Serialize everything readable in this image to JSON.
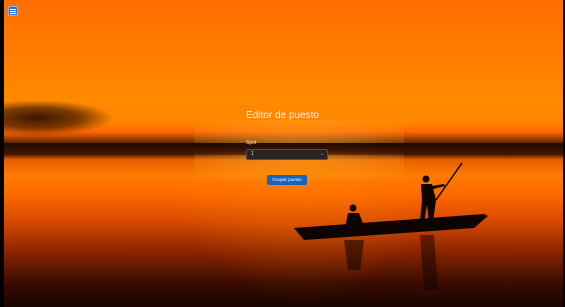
{
  "header": {
    "menu_icon": "hamburger-menu-icon"
  },
  "page": {
    "title": "Editor de puesto"
  },
  "form": {
    "spot_label": "Spot",
    "spot_value": "1",
    "submit_label": "Ocupar puesto"
  },
  "colors": {
    "primary_button": "#1565c0",
    "sunset_orange": "#ff7c00"
  }
}
